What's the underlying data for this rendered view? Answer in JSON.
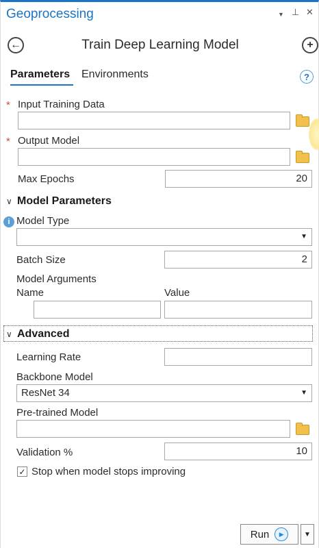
{
  "pane": {
    "title": "Geoprocessing",
    "menu_glyph": "▼",
    "pin_glyph": "⊥",
    "close_glyph": "✕"
  },
  "tool": {
    "title": "Train Deep Learning Model",
    "back_glyph": "←",
    "add_glyph": "+"
  },
  "tabs": [
    {
      "label": "Parameters",
      "active": true
    },
    {
      "label": "Environments",
      "active": false
    }
  ],
  "help_glyph": "?",
  "required_marker": "*",
  "params": {
    "input_training_data": {
      "label": "Input Training Data",
      "value": ""
    },
    "output_model": {
      "label": "Output Model",
      "value": ""
    },
    "max_epochs": {
      "label": "Max Epochs",
      "value": "20"
    }
  },
  "model_parameters": {
    "header": "Model Parameters",
    "info_glyph": "i",
    "model_type": {
      "label": "Model Type",
      "value": ""
    },
    "batch_size": {
      "label": "Batch Size",
      "value": "2"
    },
    "model_arguments": {
      "label": "Model Arguments",
      "col_name": "Name",
      "col_value": "Value",
      "name_value": "",
      "value_value": ""
    }
  },
  "advanced": {
    "header": "Advanced",
    "learning_rate": {
      "label": "Learning Rate",
      "value": ""
    },
    "backbone_model": {
      "label": "Backbone Model",
      "value": "ResNet 34"
    },
    "pretrained_model": {
      "label": "Pre-trained Model",
      "value": ""
    },
    "validation": {
      "label": "Validation %",
      "value": "10"
    },
    "stop_checkbox": {
      "label": "Stop when model stops improving",
      "checked": true,
      "check_glyph": "✓"
    }
  },
  "run": {
    "label": "Run",
    "play_glyph": "▶",
    "drop_glyph": "▼"
  },
  "colors": {
    "accent": "#1b74c6",
    "required": "#d14c2a",
    "info": "#5a9fd8"
  }
}
